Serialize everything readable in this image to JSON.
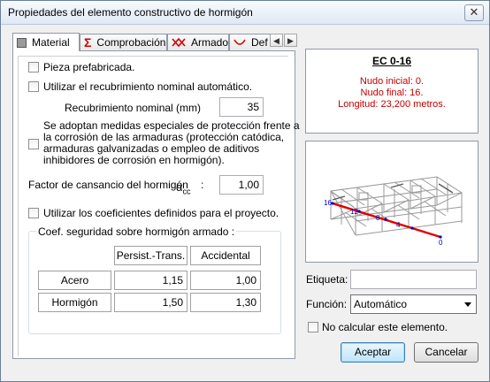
{
  "window": {
    "title": "Propiedades del elemento constructivo de hormigón",
    "close_glyph": "✕"
  },
  "tabs": [
    {
      "label": "Material",
      "icon": "square-icon"
    },
    {
      "label": "Comprobación",
      "icon": "sigma-icon"
    },
    {
      "label": "Armado",
      "icon": "rebar-icon"
    },
    {
      "label": "Def",
      "icon": "deformation-icon"
    }
  ],
  "tab_scroll": {
    "left": "◀",
    "right": "▶"
  },
  "material": {
    "prefab_label": "Pieza prefabricada.",
    "nominal_cover_label": "Utilizar el recubrimiento nominal automático.",
    "cover_field_label": "Recubrimiento nominal (mm)",
    "cover_value": "35",
    "special_measures_lines": [
      "Se adoptan medidas especiales de protección frente a",
      "la corrosión de las armaduras (protección catódica,",
      "armaduras galvanizadas o empleo de aditivos",
      "inhibidores de corrosión en hormigón)."
    ],
    "fatigue_label": "Factor de cansancio del hormigón",
    "fatigue_symbol": "α",
    "fatigue_sub": "cc",
    "fatigue_colon": ":",
    "fatigue_value": "1,00",
    "project_coef_label": "Utilizar los coeficientes definidos para el proyecto.",
    "safety_group_title": "Coef. seguridad sobre hormigón armado :",
    "table": {
      "columns": [
        "Persist.-Trans.",
        "Accidental"
      ],
      "rows": [
        {
          "label": "Acero",
          "values": [
            "1,15",
            "1,00"
          ]
        },
        {
          "label": "Hormigón",
          "values": [
            "1,50",
            "1,30"
          ]
        }
      ]
    }
  },
  "info": {
    "code": "EC 0-16",
    "start_node": "Nudo inicial: 0.",
    "end_node": "Nudo final: 16.",
    "length": "Longitud: 23,200 metros."
  },
  "view3d": {
    "node_labels": [
      "16",
      "12",
      "8",
      "4",
      "0"
    ],
    "highlight_color": "#e00000",
    "label_color": "#0000c0"
  },
  "right": {
    "tag_label": "Etiqueta:",
    "tag_value": "",
    "function_label": "Función:",
    "function_value": "Automático",
    "no_calc_label": "No calcular este elemento."
  },
  "buttons": {
    "accept": "Aceptar",
    "cancel": "Cancelar"
  }
}
